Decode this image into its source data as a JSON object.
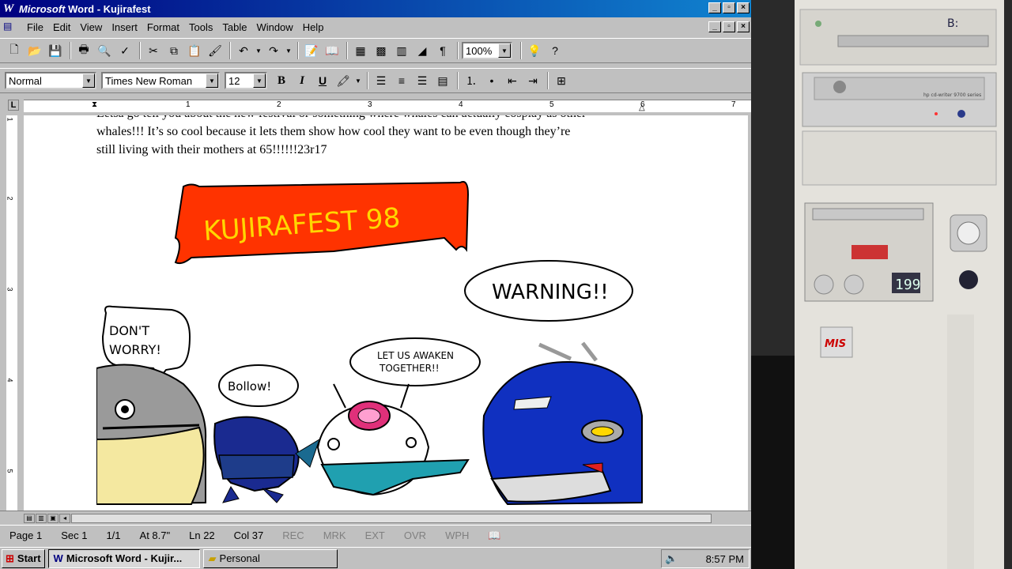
{
  "window": {
    "title": "Microsoft Word - Kujirafest",
    "title_brand": "Microsoft",
    "title_rest": " Word - Kujirafest",
    "min": "_",
    "max": "▫",
    "close": "×"
  },
  "menu": {
    "items": [
      "File",
      "Edit",
      "View",
      "Insert",
      "Format",
      "Tools",
      "Table",
      "Window",
      "Help"
    ]
  },
  "toolbar": {
    "zoom": "100%"
  },
  "format_bar": {
    "style": "Normal",
    "font": "Times New Roman",
    "size": "12",
    "bold": "B",
    "italic": "I",
    "underline": "U"
  },
  "ruler": {
    "labels": [
      "1",
      "2",
      "3",
      "4",
      "5",
      "6",
      "7"
    ],
    "tab_selector": "L",
    "vlabels": [
      "1",
      "2",
      "3",
      "4",
      "5"
    ]
  },
  "document": {
    "line1": "Letsa go tell you about the new festival or something where whales can actually cosplay as other",
    "line2": "whales!!! It’s so cool because it lets them show how cool they want to be even though they’re",
    "line3": "still living with their mothers at 65!!!!!!23r17",
    "banner": "KUJIRAFEST 98",
    "bubble_dont": "DON'T WORRY!",
    "bubble_bollow": "Bollow!",
    "bubble_awaken": "LET US AWAKEN TOGETHER!!",
    "bubble_warning": "WARNING!!"
  },
  "status": {
    "page": "Page 1",
    "sec": "Sec 1",
    "pages": "1/1",
    "at": "At 8.7\"",
    "ln": "Ln 22",
    "col": "Col 37",
    "rec": "REC",
    "mrk": "MRK",
    "ext": "EXT",
    "ovr": "OVR",
    "wph": "WPH"
  },
  "taskbar": {
    "start": "Start",
    "task1": "Microsoft Word - Kujir...",
    "task2": "Personal",
    "clock": "8:57 PM"
  },
  "photo": {
    "drive_label": "B:",
    "hp_label": "hp cd-writer 9700 series",
    "display": "199",
    "brand": "MIS"
  },
  "colors": {
    "titlebar_start": "#000080",
    "titlebar_end": "#1084d0",
    "banner": "#ff3300",
    "banner_text": "#ffd700",
    "whale_blue": "#1030c0"
  }
}
